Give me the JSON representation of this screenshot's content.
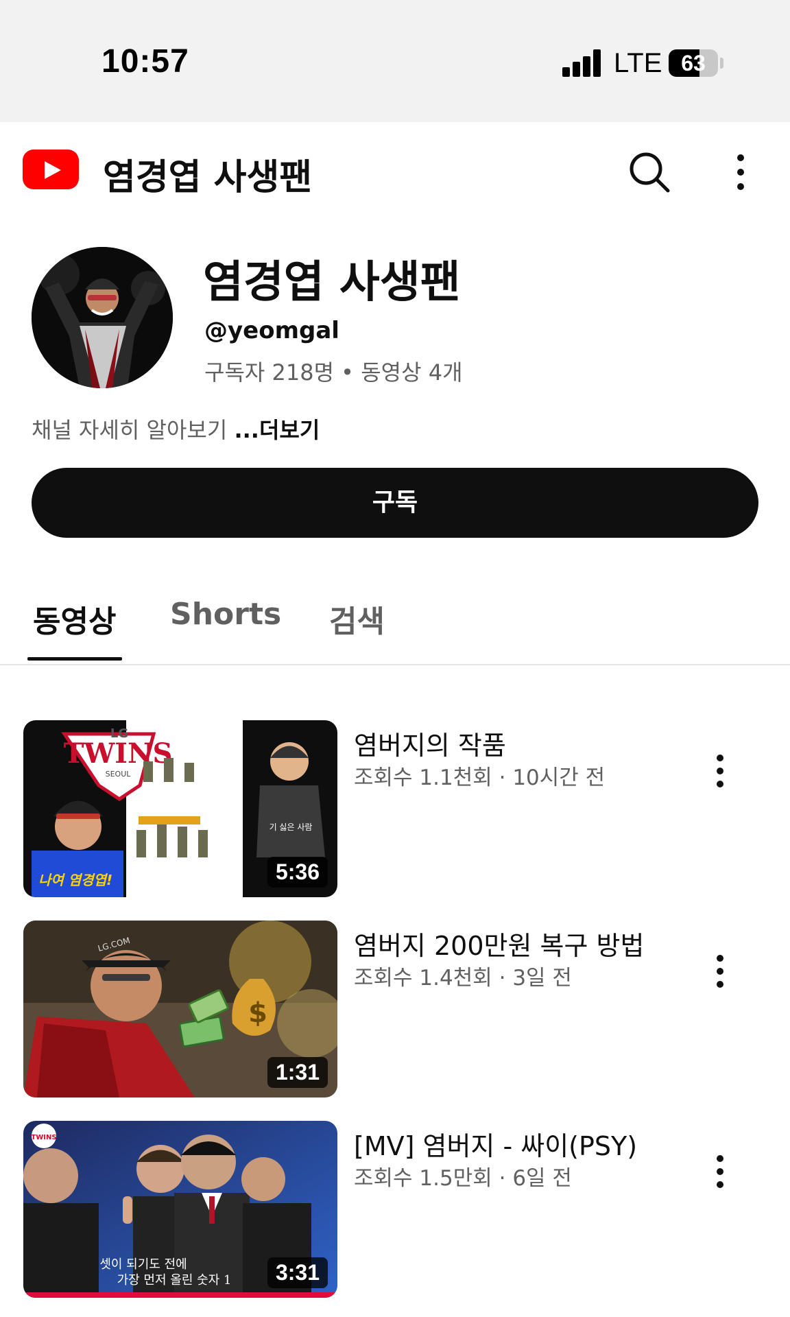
{
  "status": {
    "time": "10:57",
    "network": "LTE",
    "battery": "63",
    "battery_level": 0.63
  },
  "header": {
    "title": "염경엽 사생팬",
    "search_icon": "search-icon",
    "more_icon": "more-vert-icon"
  },
  "channel": {
    "name": "염경엽 사생팬",
    "handle": "@yeomgal",
    "stats": "구독자 218명 • 동영상 4개",
    "description": "채널 자세히 알아보기 ",
    "more": "...더보기",
    "subscribe_label": "구독"
  },
  "tabs": [
    {
      "label": "동영상",
      "active": true
    },
    {
      "label": "Shorts",
      "active": false
    },
    {
      "label": "검색",
      "active": false
    }
  ],
  "videos": [
    {
      "title": "염버지의 작품",
      "meta": "조회수 1.1천회 · 10시간 전",
      "duration": "5:36",
      "thumb_texts": [
        "LG",
        "TWINS",
        "SEOUL",
        "나여 염경엽!",
        "기 싫은 사람"
      ]
    },
    {
      "title": "염버지 200만원 복구 방법",
      "meta": "조회수 1.4천회 · 3일 전",
      "duration": "1:31",
      "thumb_texts": [
        "LG.COM"
      ]
    },
    {
      "title": "[MV] 염버지 - 싸이(PSY)",
      "meta": "조회수 1.5만회 · 6일 전",
      "duration": "3:31",
      "thumb_texts": [
        "TWINS",
        "셋이 되기도 전에",
        "가장 먼저 올린 숫자 1"
      ]
    }
  ]
}
